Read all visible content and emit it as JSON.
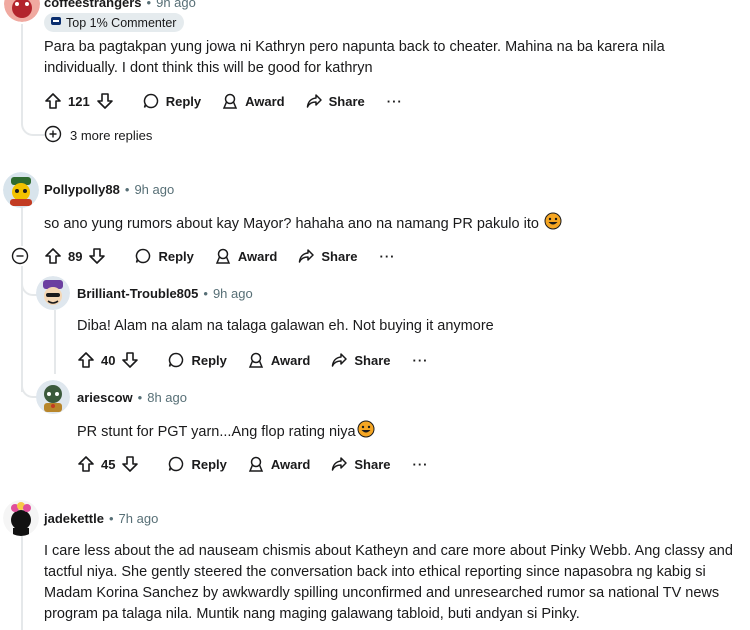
{
  "comments": [
    {
      "user": "coffeestrangers",
      "time": "9h ago",
      "flair": "Top 1% Commenter",
      "body": "Para ba pagtakpan yung jowa ni Kathryn pero napunta back to cheater. Mahina na ba karera nila individually. I dont think this will be good for kathryn",
      "votes": "121",
      "more_replies": "3 more replies"
    },
    {
      "user": "Pollypolly88",
      "time": "9h ago",
      "body": "so ano yung rumors about kay Mayor? hahaha ano na namang PR pakulo ito",
      "votes": "89",
      "replies": [
        {
          "user": "Brilliant-Trouble805",
          "time": "9h ago",
          "body": "Diba! Alam na alam na talaga galawan eh. Not buying it anymore",
          "votes": "40"
        },
        {
          "user": "ariescow",
          "time": "8h ago",
          "body": "PR stunt for PGT yarn...Ang flop rating niya",
          "votes": "45"
        }
      ]
    },
    {
      "user": "jadekettle",
      "time": "7h ago",
      "body": "I care less about the ad nauseam chismis about Katheyn and care more about Pinky Webb. Ang classy and tactful niya. She gently steered the conversation back into ethical reporting since napasobra ng kabig si Madam Korina Sanchez by awkwardly spilling unconfirmed and unresearched rumor sa national TV news program pa talaga nila. Muntik nang maging galawang tabloid, buti andyan si Pinky."
    }
  ],
  "labels": {
    "reply": "Reply",
    "award": "Award",
    "share": "Share",
    "more": "···",
    "dot": "•"
  },
  "colors": {
    "text": "#1a1a1b",
    "meta": "#576f76",
    "badge_bg": "#e5ebee",
    "thread_line": "#e5e8ea"
  }
}
